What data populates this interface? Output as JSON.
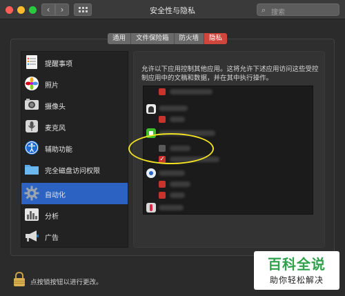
{
  "window": {
    "title": "安全性与隐私"
  },
  "search": {
    "placeholder": "搜索"
  },
  "tabs": [
    {
      "label": "通用",
      "active": false
    },
    {
      "label": "文件保险箱",
      "active": false
    },
    {
      "label": "防火墙",
      "active": false
    },
    {
      "label": "隐私",
      "active": true
    }
  ],
  "sidebar": {
    "items": [
      {
        "label": "提醒事项",
        "icon": "reminders-icon"
      },
      {
        "label": "照片",
        "icon": "photos-icon"
      },
      {
        "label": "摄像头",
        "icon": "camera-icon"
      },
      {
        "label": "麦克风",
        "icon": "microphone-icon"
      },
      {
        "label": "辅助功能",
        "icon": "accessibility-icon"
      },
      {
        "label": "完全磁盘访问权限",
        "icon": "folder-icon"
      },
      {
        "label": "自动化",
        "icon": "gear-icon",
        "active": true
      },
      {
        "label": "分析",
        "icon": "analytics-icon"
      },
      {
        "label": "广告",
        "icon": "megaphone-icon"
      }
    ]
  },
  "panel": {
    "description": "允许以下应用控制其他应用。这将允许下述应用访问这些受控制应用中的文稿和数据，并在其中执行操作。",
    "rows": [
      {
        "checked": true
      },
      {
        "checked": true
      },
      {
        "checked": true
      },
      {
        "checked": false
      },
      {
        "checked": true
      },
      {
        "checked": true
      },
      {
        "checked": true
      }
    ]
  },
  "footer": {
    "lock_text": "点按锁按钮以进行更改。"
  },
  "watermark": {
    "top": "百科全说",
    "bottom": "助你轻松解决"
  },
  "colors": {
    "accent": "#2c63c2",
    "tab_active": "#d0463d",
    "highlight": "#f1e223",
    "watermark_green": "#2fa04b"
  }
}
